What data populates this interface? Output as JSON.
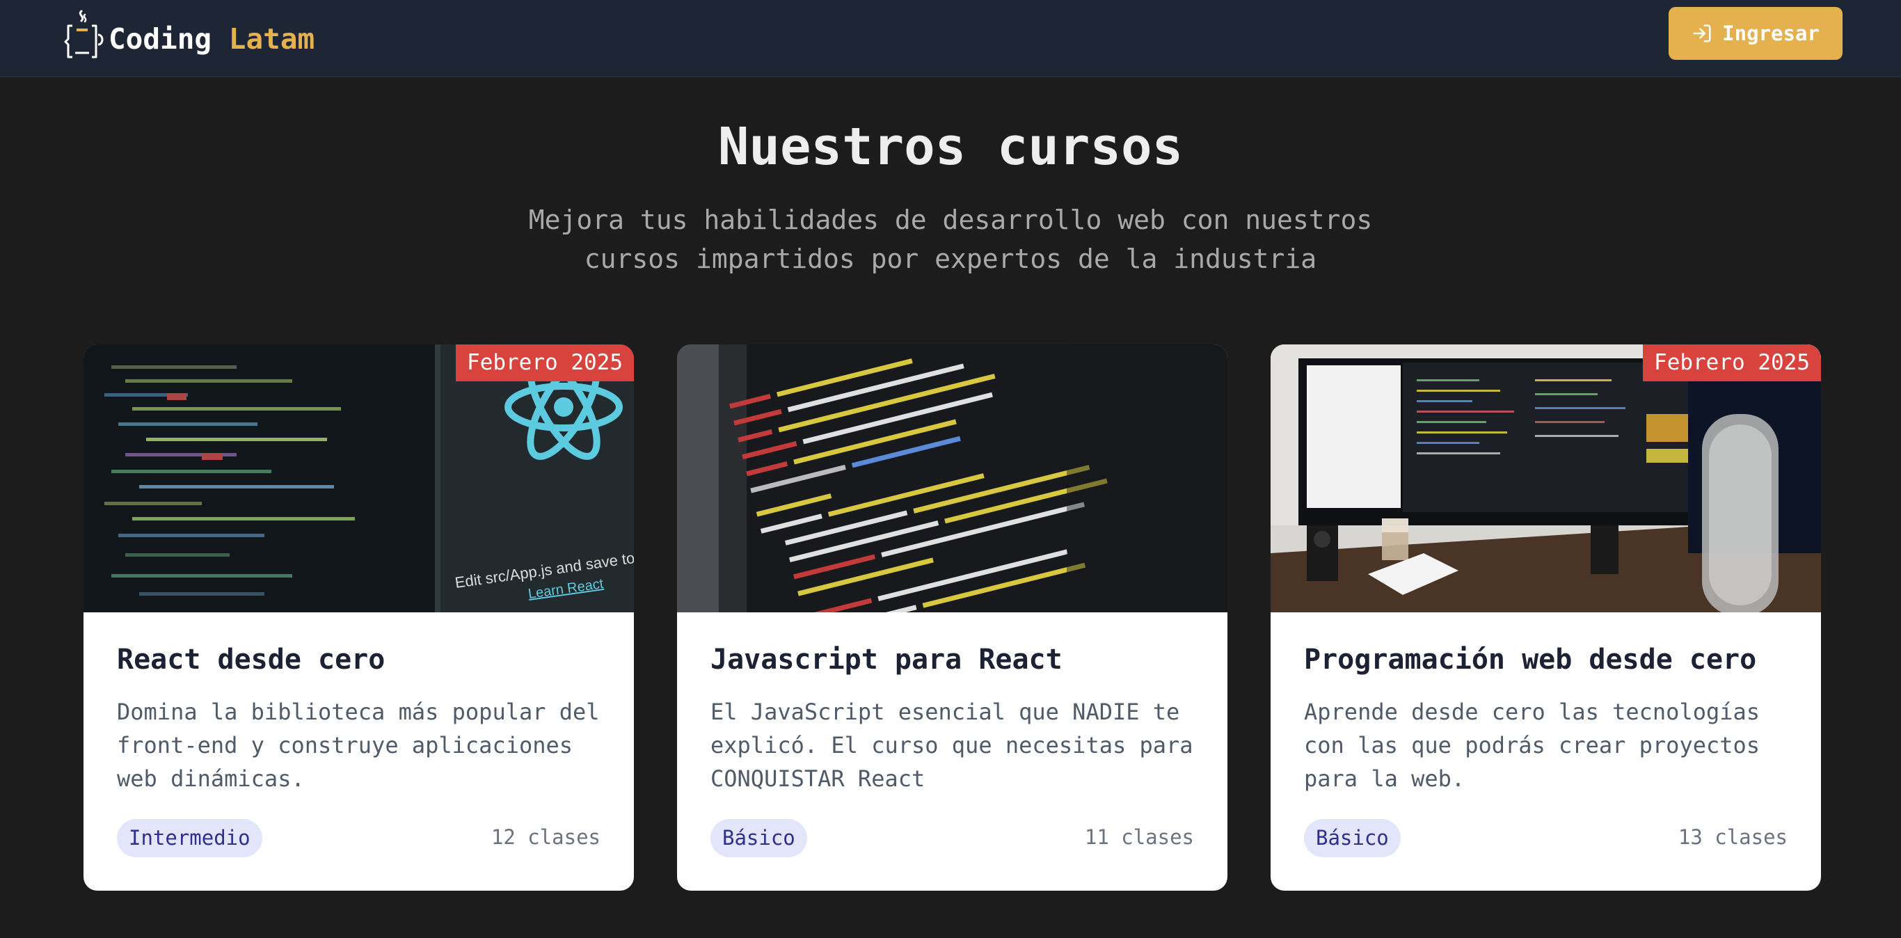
{
  "brand": {
    "name_part1": "Coding",
    "name_part2": "Latam",
    "accent_color": "#e5b04e"
  },
  "nav": {
    "login_label": "Ingresar",
    "login_icon": "login-arrow-icon"
  },
  "hero": {
    "title": "Nuestros cursos",
    "subtitle_line1": "Mejora tus habilidades de desarrollo web con nuestros",
    "subtitle_line2": "cursos impartidos por expertos de la industria"
  },
  "courses": [
    {
      "date_badge": "Febrero 2025",
      "title": "React desde cero",
      "description": "Domina la biblioteca más popular del front-end y construye aplicaciones web dinámicas.",
      "level": "Intermedio",
      "classes": "12 clases",
      "image": "react-code-screen",
      "image_text_1": "Edit src/App.js and save to rel",
      "image_text_2": "Learn React"
    },
    {
      "date_badge": "",
      "title": "Javascript para React",
      "description": "El JavaScript esencial que NADIE te explicó. El curso que necesitas para CONQUISTAR React",
      "level": "Básico",
      "classes": "11 clases",
      "image": "php-code-closeup"
    },
    {
      "date_badge": "Febrero 2025",
      "title": "Programación web desde cero",
      "description": "Aprende desde cero las tecnologías con las que podrás crear proyectos para la web.",
      "level": "Básico",
      "classes": "13 clases",
      "image": "desk-monitor-setup"
    }
  ],
  "colors": {
    "navbar_bg": "#1e2636",
    "page_bg": "#1c1c1c",
    "date_badge_bg": "#d9433e",
    "level_badge_bg": "#e3e6fb",
    "level_badge_text": "#2e2f8f"
  }
}
